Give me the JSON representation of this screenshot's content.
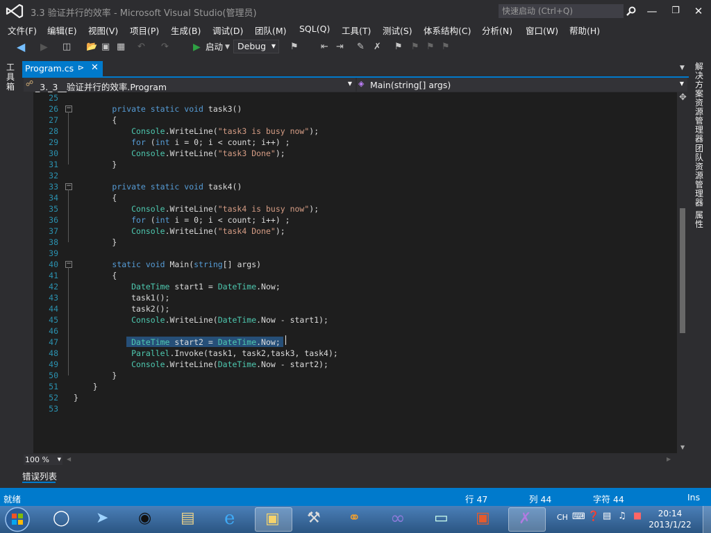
{
  "window": {
    "title": "3.3 验证并行的效率 - Microsoft Visual Studio(管理员)",
    "quick_launch_placeholder": "快速启动 (Ctrl+Q)"
  },
  "menu": [
    "文件(F)",
    "编辑(E)",
    "视图(V)",
    "项目(P)",
    "生成(B)",
    "调试(D)",
    "团队(M)",
    "SQL(Q)",
    "工具(T)",
    "测试(S)",
    "体系结构(C)",
    "分析(N)",
    "窗口(W)",
    "帮助(H)"
  ],
  "toolbar": {
    "start_label": "启动",
    "config_value": "Debug"
  },
  "left_panel": {
    "toolbox_label": "工具箱"
  },
  "right_panel": {
    "solution_explorer": "解决方案资源管理器",
    "team_explorer": "团队资源管理器",
    "properties": "属性"
  },
  "tab": {
    "filename": "Program.cs"
  },
  "navbar": {
    "class_path": "_3._3__验证并行的效率.Program",
    "member": "Main(string[] args)"
  },
  "editor": {
    "lines": [
      {
        "n": "25",
        "t": ""
      },
      {
        "n": "26",
        "t": "        private static void task3()"
      },
      {
        "n": "27",
        "t": "        {"
      },
      {
        "n": "28",
        "t": "            Console.WriteLine(\"task3 is busy now\");"
      },
      {
        "n": "29",
        "t": "            for (int i = 0; i < count; i++) ;"
      },
      {
        "n": "30",
        "t": "            Console.WriteLine(\"task3 Done\");"
      },
      {
        "n": "31",
        "t": "        }"
      },
      {
        "n": "32",
        "t": ""
      },
      {
        "n": "33",
        "t": "        private static void task4()"
      },
      {
        "n": "34",
        "t": "        {"
      },
      {
        "n": "35",
        "t": "            Console.WriteLine(\"task4 is busy now\");"
      },
      {
        "n": "36",
        "t": "            for (int i = 0; i < count; i++) ;"
      },
      {
        "n": "37",
        "t": "            Console.WriteLine(\"task4 Done\");"
      },
      {
        "n": "38",
        "t": "        }"
      },
      {
        "n": "39",
        "t": ""
      },
      {
        "n": "40",
        "t": "        static void Main(string[] args)"
      },
      {
        "n": "41",
        "t": "        {"
      },
      {
        "n": "42",
        "t": "            DateTime start1 = DateTime.Now;"
      },
      {
        "n": "43",
        "t": "            task1();"
      },
      {
        "n": "44",
        "t": "            task2();"
      },
      {
        "n": "45",
        "t": "            Console.WriteLine(DateTime.Now - start1);"
      },
      {
        "n": "46",
        "t": ""
      },
      {
        "n": "47",
        "t": "            DateTime start2 = DateTime.Now;"
      },
      {
        "n": "48",
        "t": "            Parallel.Invoke(task1, task2,task3, task4);"
      },
      {
        "n": "49",
        "t": "            Console.WriteLine(DateTime.Now - start2);"
      },
      {
        "n": "50",
        "t": "        }"
      },
      {
        "n": "51",
        "t": "    }"
      },
      {
        "n": "52",
        "t": "}"
      },
      {
        "n": "53",
        "t": ""
      }
    ]
  },
  "zoom": "100 %",
  "error_list_label": "错误列表",
  "status": {
    "ready": "就绪",
    "line": "行 47",
    "col": "列 44",
    "char": "字符 44",
    "mode": "Ins"
  },
  "tray": {
    "lang": "CH",
    "time": "20:14",
    "date": "2013/1/22"
  },
  "colors": {
    "accent": "#007acc",
    "editor_bg": "#1e1e1e",
    "keyword": "#569cd6",
    "type": "#4ec9b0",
    "string": "#d69d85"
  }
}
